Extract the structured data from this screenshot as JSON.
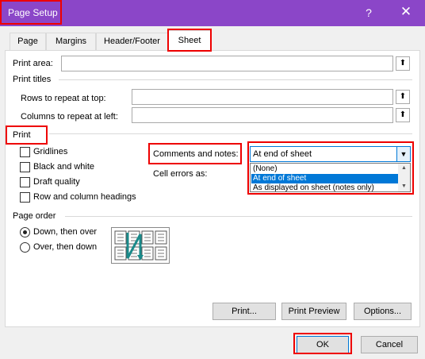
{
  "window": {
    "title": "Page Setup",
    "help_glyph": "?",
    "close_glyph": "✕"
  },
  "tabs": [
    {
      "label": "Page"
    },
    {
      "label": "Margins"
    },
    {
      "label": "Header/Footer"
    },
    {
      "label": "Sheet"
    }
  ],
  "sheet": {
    "print_area_label": "Print area:",
    "print_area_value": "",
    "print_titles_label": "Print titles",
    "rows_repeat_label": "Rows to repeat at top:",
    "rows_repeat_value": "",
    "cols_repeat_label": "Columns to repeat at left:",
    "cols_repeat_value": "",
    "picker_glyph": "⬆",
    "print_label": "Print",
    "checkboxes": [
      {
        "label": "Gridlines",
        "checked": false
      },
      {
        "label": "Black and white",
        "checked": false
      },
      {
        "label": "Draft quality",
        "checked": false
      },
      {
        "label": "Row and column headings",
        "checked": false
      }
    ],
    "comments_label": "Comments and notes:",
    "comments_value": "At end of sheet",
    "comments_options": [
      "(None)",
      "At end of sheet",
      "As displayed on sheet (notes only)"
    ],
    "cell_errors_label": "Cell errors as:",
    "page_order_label": "Page order",
    "page_order_options": [
      {
        "label": "Down, then over",
        "checked": true
      },
      {
        "label": "Over, then down",
        "checked": false
      }
    ]
  },
  "buttons": {
    "print": "Print...",
    "print_preview": "Print Preview",
    "options": "Options...",
    "ok": "OK",
    "cancel": "Cancel"
  },
  "colors": {
    "titlebar": "#8b46c8",
    "highlight": "#ee0000",
    "selection": "#0078d7"
  }
}
